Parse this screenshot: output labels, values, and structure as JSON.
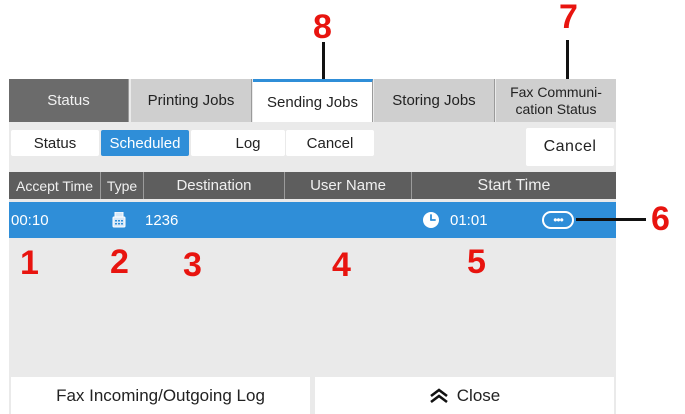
{
  "tabs": [
    {
      "label": "Status"
    },
    {
      "label": "Printing Jobs"
    },
    {
      "label": "Sending Jobs"
    },
    {
      "label": "Storing Jobs"
    },
    {
      "label": "Fax Communi-\ncation Status"
    }
  ],
  "subtabs": {
    "status": "Status",
    "scheduled": "Scheduled",
    "log": "Log",
    "cancel": "Cancel",
    "cancel_right": "Cancel"
  },
  "table": {
    "headers": [
      "Accept Time",
      "Type",
      "Destination",
      "User Name",
      "Start Time"
    ],
    "row": {
      "accept_time": "00:10",
      "type_icon": "fax-icon",
      "destination": "1236",
      "user_name": "",
      "start_time_icon": "clock-icon",
      "start_time": "01:01",
      "more_icon": "more-icon"
    }
  },
  "bottom": {
    "fax_log": "Fax Incoming/Outgoing Log",
    "close": "Close"
  },
  "callouts": {
    "c1": "1",
    "c2": "2",
    "c3": "3",
    "c4": "4",
    "c5": "5",
    "c6": "6",
    "c7": "7",
    "c8": "8"
  },
  "colors": {
    "accent": "#2f8ed8",
    "callout": "#e8140f",
    "header_bg": "#5e5e5e"
  }
}
